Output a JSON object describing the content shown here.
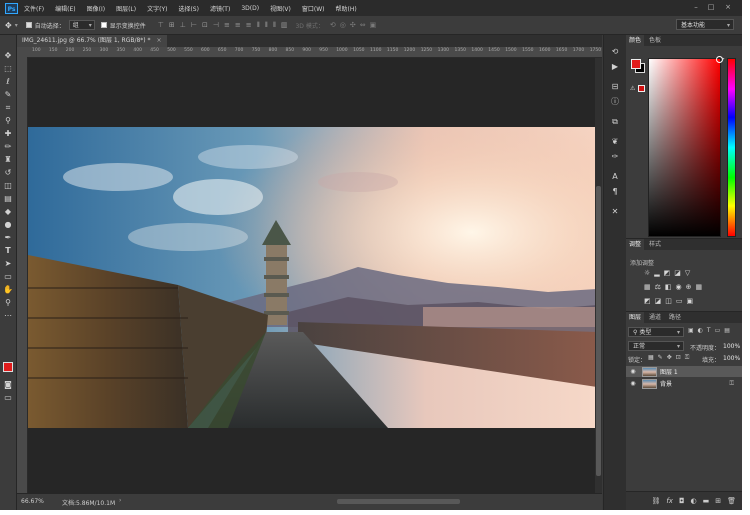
{
  "menubar": {
    "logo": "Ps",
    "items": [
      "文件(F)",
      "编辑(E)",
      "图像(I)",
      "图层(L)",
      "文字(Y)",
      "选择(S)",
      "滤镜(T)",
      "3D(D)",
      "视图(V)",
      "窗口(W)",
      "帮助(H)"
    ],
    "controls": [
      "–",
      "□",
      "×"
    ]
  },
  "options": {
    "move_icon": "move-icon",
    "auto_select_label": "自动选择：",
    "auto_select_value": "组",
    "transform_label": "显示变换控件",
    "mode_3d": "3D 模式：",
    "workspace": "基本功能"
  },
  "document": {
    "tab": "IMG_24611.jpg @ 66.7% (图层 1, RGB/8*) *",
    "tab_close": "×",
    "ruler_ticks": [
      "100",
      "150",
      "200",
      "250",
      "300",
      "350",
      "400",
      "450",
      "500",
      "550",
      "600",
      "650",
      "700",
      "750",
      "800",
      "850",
      "900",
      "950",
      "1000",
      "1050",
      "1100",
      "1150",
      "1200",
      "1250",
      "1300",
      "1350",
      "1400",
      "1450",
      "1500",
      "1550",
      "1600",
      "1650",
      "1700",
      "1750"
    ]
  },
  "status": {
    "zoom": "66.67%",
    "docsize": "文档:5.86M/10.1M",
    "arrow": "›"
  },
  "panels": {
    "color_tab": "颜色",
    "swatches_tab": "色板",
    "adjust_tab": "调整",
    "styles_tab": "样式",
    "adjust_subtitle": "添加调整",
    "layers_tab": "图层",
    "channels_tab": "通道",
    "paths_tab": "路径",
    "filter_kind": "类型",
    "blend_mode": "正常",
    "opacity_label": "不透明度：",
    "opacity_value": "100%",
    "lock_label": "锁定：",
    "fill_label": "填充：",
    "fill_value": "100%",
    "layers": [
      {
        "name": "图层 1",
        "selected": true
      },
      {
        "name": "背景",
        "selected": false
      }
    ]
  },
  "colors": {
    "foreground": "#e11b1b",
    "background": "#000000",
    "app_bg": "#3a3a3a",
    "pasteboard": "#262626"
  }
}
